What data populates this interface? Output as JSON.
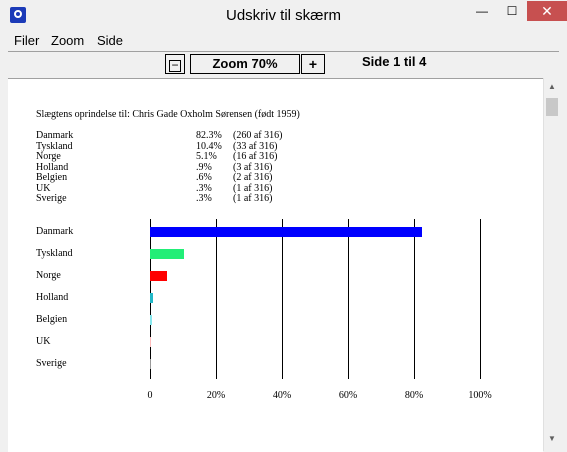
{
  "window": {
    "title": "Udskriv til skærm",
    "min": "—",
    "max": "☐",
    "close": "✕"
  },
  "menu": [
    {
      "label": "Filer"
    },
    {
      "label": "Zoom"
    },
    {
      "label": "Side"
    }
  ],
  "toolbar": {
    "zoom_minus": "−",
    "zoom_label": "Zoom 70%",
    "zoom_plus": "+",
    "page_label": "Side 1 til 4"
  },
  "document": {
    "heading": "Slægtens oprindelse til: Chris Gade Oxholm Sørensen (født 1959)",
    "stats": [
      {
        "country": "Danmark",
        "pct": "82.3%",
        "count": "(260 af 316)"
      },
      {
        "country": "Tyskland",
        "pct": "10.4%",
        "count": "(33 af 316)"
      },
      {
        "country": "Norge",
        "pct": "5.1%",
        "count": "(16 af 316)"
      },
      {
        "country": "Holland",
        "pct": ".9%",
        "count": "(3 af 316)"
      },
      {
        "country": "Belgien",
        "pct": ".6%",
        "count": "(2 af 316)"
      },
      {
        "country": "UK",
        "pct": ".3%",
        "count": "(1 af 316)"
      },
      {
        "country": "Sverige",
        "pct": ".3%",
        "count": "(1 af 316)"
      }
    ]
  },
  "chart_data": {
    "type": "bar",
    "orientation": "horizontal",
    "categories": [
      "Danmark",
      "Tyskland",
      "Norge",
      "Holland",
      "Belgien",
      "UK",
      "Sverige"
    ],
    "values": [
      82.3,
      10.4,
      5.1,
      0.9,
      0.6,
      0.3,
      0.3
    ],
    "colors": [
      "#0000ff",
      "#22ee77",
      "#ff0000",
      "#22b8c8",
      "#88e8ee",
      "#ffbbbb",
      "#999999"
    ],
    "x_ticks": [
      "0",
      "20%",
      "40%",
      "60%",
      "80%",
      "100%"
    ],
    "xlim": [
      0,
      100
    ],
    "grid": true
  }
}
